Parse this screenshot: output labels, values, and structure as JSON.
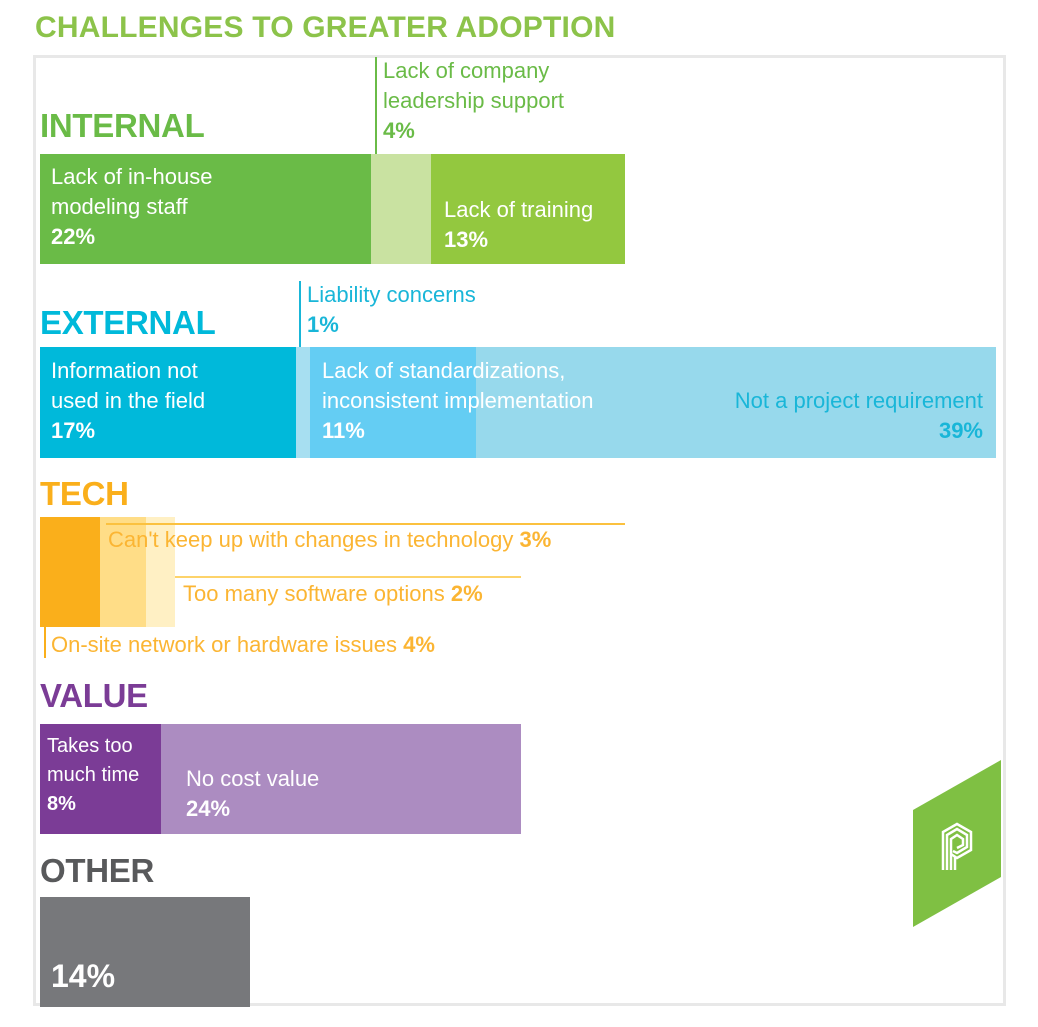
{
  "title": "CHALLENGES TO GREATER ADOPTION",
  "colors": {
    "title": "#8cc34a",
    "internal": [
      "#6abb47",
      "#c9e2a1",
      "#93c83f"
    ],
    "internal_text": "#6abb47",
    "external": [
      "#00b9da",
      "#a7dff1",
      "#64cdf3",
      "#97d9ec"
    ],
    "external_text": "#19b6d8",
    "tech": [
      "#faaf1b",
      "#ffdd87",
      "#fff0c4"
    ],
    "tech_text": "#fbb533",
    "value": [
      "#7b3c96",
      "#ac8cc1"
    ],
    "value_text": "#7b3c96",
    "other": [
      "#77787b"
    ],
    "other_text": "#58595b",
    "logo": "#7fc043"
  },
  "chart_data": {
    "type": "bar",
    "stacked": true,
    "orientation": "horizontal",
    "title": "CHALLENGES TO GREATER ADOPTION",
    "unit": "%",
    "groups": [
      {
        "name": "INTERNAL",
        "segments": [
          {
            "label": "Lack of in-house\nmodeling staff",
            "value": 22
          },
          {
            "label": "Lack of company\nleadership support",
            "value": 4
          },
          {
            "label": "Lack of training",
            "value": 13
          }
        ]
      },
      {
        "name": "EXTERNAL",
        "segments": [
          {
            "label": "Information not\nused in the field",
            "value": 17
          },
          {
            "label": "Liability concerns",
            "value": 1
          },
          {
            "label": "Lack of standardizations,\ninconsistent implementation",
            "value": 11
          },
          {
            "label": "Not a project requirement",
            "value": 39
          }
        ]
      },
      {
        "name": "TECH",
        "segments": [
          {
            "label": "On-site network or hardware issues",
            "value": 4
          },
          {
            "label": "Can't keep up with changes in technology",
            "value": 3
          },
          {
            "label": "Too many software options",
            "value": 2
          }
        ]
      },
      {
        "name": "VALUE",
        "segments": [
          {
            "label": "Takes too\nmuch time",
            "value": 8
          },
          {
            "label": "No cost value",
            "value": 24
          }
        ]
      },
      {
        "name": "OTHER",
        "segments": [
          {
            "label": "",
            "value": 14
          }
        ]
      }
    ]
  },
  "display": {
    "internal": {
      "name": "INTERNAL",
      "s0_label": "Lack of in-house\nmodeling staff",
      "s0_pct": "22%",
      "s1_label": "Lack of company\nleadership support",
      "s1_pct": "4%",
      "s2_label": "Lack of training",
      "s2_pct": "13%"
    },
    "external": {
      "name": "EXTERNAL",
      "s0_label": "Information not\nused in the field",
      "s0_pct": "17%",
      "s1_label": "Liability concerns",
      "s1_pct": "1%",
      "s2_label": "Lack of standardizations,\ninconsistent implementation",
      "s2_pct": "11%",
      "s3_label": "Not a project requirement",
      "s3_pct": "39%"
    },
    "tech": {
      "name": "TECH",
      "s0_label": "On-site network or hardware issues",
      "s0_pct": "4%",
      "s1_label": "Can't keep up with changes in technology",
      "s1_pct": "3%",
      "s2_label": "Too many software options",
      "s2_pct": "2%"
    },
    "value": {
      "name": "VALUE",
      "s0_label": "Takes too\nmuch time",
      "s0_pct": "8%",
      "s1_label": "No cost value",
      "s1_pct": "24%"
    },
    "other": {
      "name": "OTHER",
      "s0_pct": "14%"
    }
  },
  "logo": {
    "icon": "stacked-p-logo-icon"
  }
}
